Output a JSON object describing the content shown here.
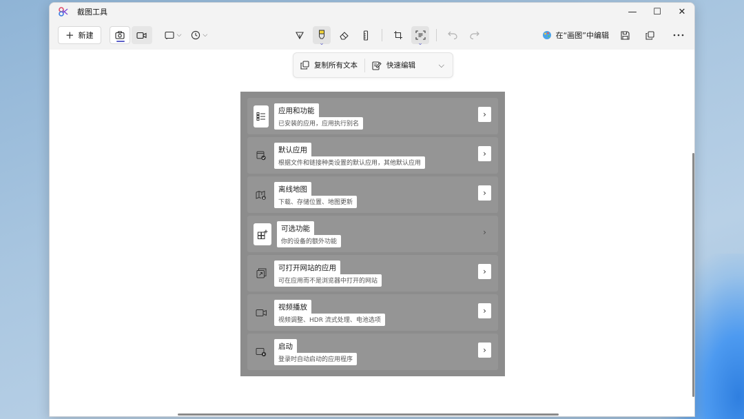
{
  "window": {
    "title": "截图工具",
    "controls": {
      "minimize": "—",
      "maximize": "☐",
      "close": "✕"
    }
  },
  "toolbar": {
    "new_label": "新建",
    "paint_edit_label": "在“画图”中编辑",
    "accent_color": "#5b5fc7"
  },
  "text_actions": {
    "copy_all_label": "复制所有文本",
    "quick_edit_label": "快速编辑"
  },
  "snapshot": {
    "items": [
      {
        "title": "应用和功能",
        "subtitle": "已安装的应用，应用执行别名",
        "icon": "apps-list-icon"
      },
      {
        "title": "默认应用",
        "subtitle": "根据文件和链接种类设置的默认应用，其他默认应用",
        "icon": "default-apps-icon"
      },
      {
        "title": "离线地图",
        "subtitle": "下载、存储位置、地图更新",
        "icon": "offline-map-icon"
      },
      {
        "title": "可选功能",
        "subtitle": "你的设备的额外功能",
        "icon": "optional-features-icon"
      },
      {
        "title": "可打开网站的应用",
        "subtitle": "可在应用而不是浏览器中打开的网站",
        "icon": "apps-for-websites-icon"
      },
      {
        "title": "视频播放",
        "subtitle": "视频调整、HDR 流式处理、电池选项",
        "icon": "video-playback-icon"
      },
      {
        "title": "启动",
        "subtitle": "登录时自动启动的应用程序",
        "icon": "startup-icon"
      }
    ]
  }
}
